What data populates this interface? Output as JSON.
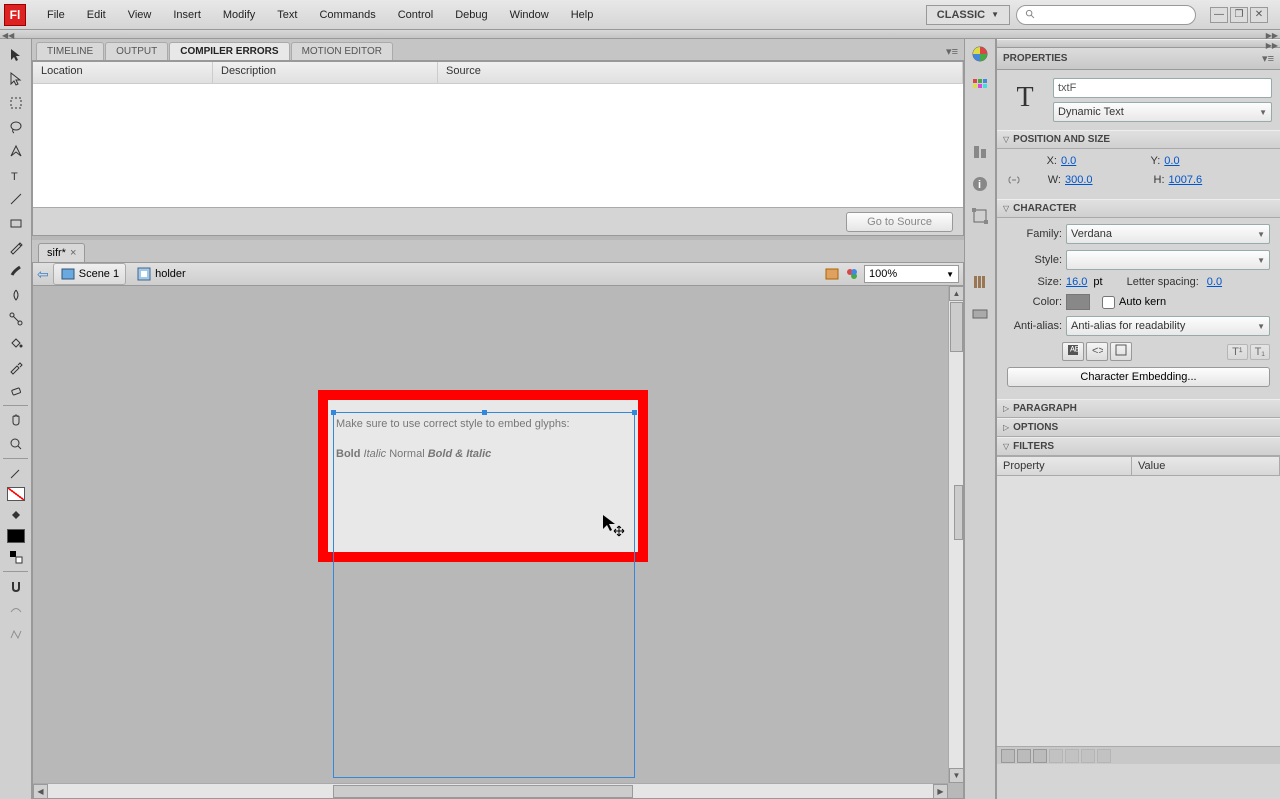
{
  "menubar": {
    "app_glyph": "Fl",
    "items": [
      "File",
      "Edit",
      "View",
      "Insert",
      "Modify",
      "Text",
      "Commands",
      "Control",
      "Debug",
      "Window",
      "Help"
    ],
    "workspace": "CLASSIC",
    "search_placeholder": ""
  },
  "panel_tabs": {
    "items": [
      "TIMELINE",
      "OUTPUT",
      "COMPILER ERRORS",
      "MOTION EDITOR"
    ],
    "active_index": 2
  },
  "error_panel": {
    "columns": [
      "Location",
      "Description",
      "Source"
    ],
    "goto_button": "Go to Source"
  },
  "document": {
    "tab_label": "sifr*",
    "breadcrumb": {
      "back": "⇦",
      "scene": "Scene 1",
      "symbol": "holder"
    },
    "zoom": "100%"
  },
  "stage": {
    "text_line1": "Make sure to use correct style to embed glyphs:",
    "text_bold": "Bold",
    "text_italic": "Italic",
    "text_normal": "Normal",
    "text_bolditalic": "Bold & Italic"
  },
  "properties": {
    "panel_title": "PROPERTIES",
    "instance_name": "txtF",
    "text_type": "Dynamic Text",
    "sections": {
      "position": {
        "title": "POSITION AND SIZE",
        "x_label": "X:",
        "x": "0.0",
        "y_label": "Y:",
        "y": "0.0",
        "w_label": "W:",
        "w": "300.0",
        "h_label": "H:",
        "h": "1007.6"
      },
      "character": {
        "title": "CHARACTER",
        "family_label": "Family:",
        "family": "Verdana",
        "style_label": "Style:",
        "style": "",
        "size_label": "Size:",
        "size": "16.0",
        "size_unit": "pt",
        "spacing_label": "Letter spacing:",
        "spacing": "0.0",
        "color_label": "Color:",
        "autokern_label": "Auto kern",
        "antialias_label": "Anti-alias:",
        "antialias": "Anti-alias for readability",
        "embed_button": "Character Embedding..."
      },
      "paragraph": {
        "title": "PARAGRAPH"
      },
      "options": {
        "title": "OPTIONS"
      },
      "filters": {
        "title": "FILTERS",
        "col_property": "Property",
        "col_value": "Value"
      }
    }
  }
}
